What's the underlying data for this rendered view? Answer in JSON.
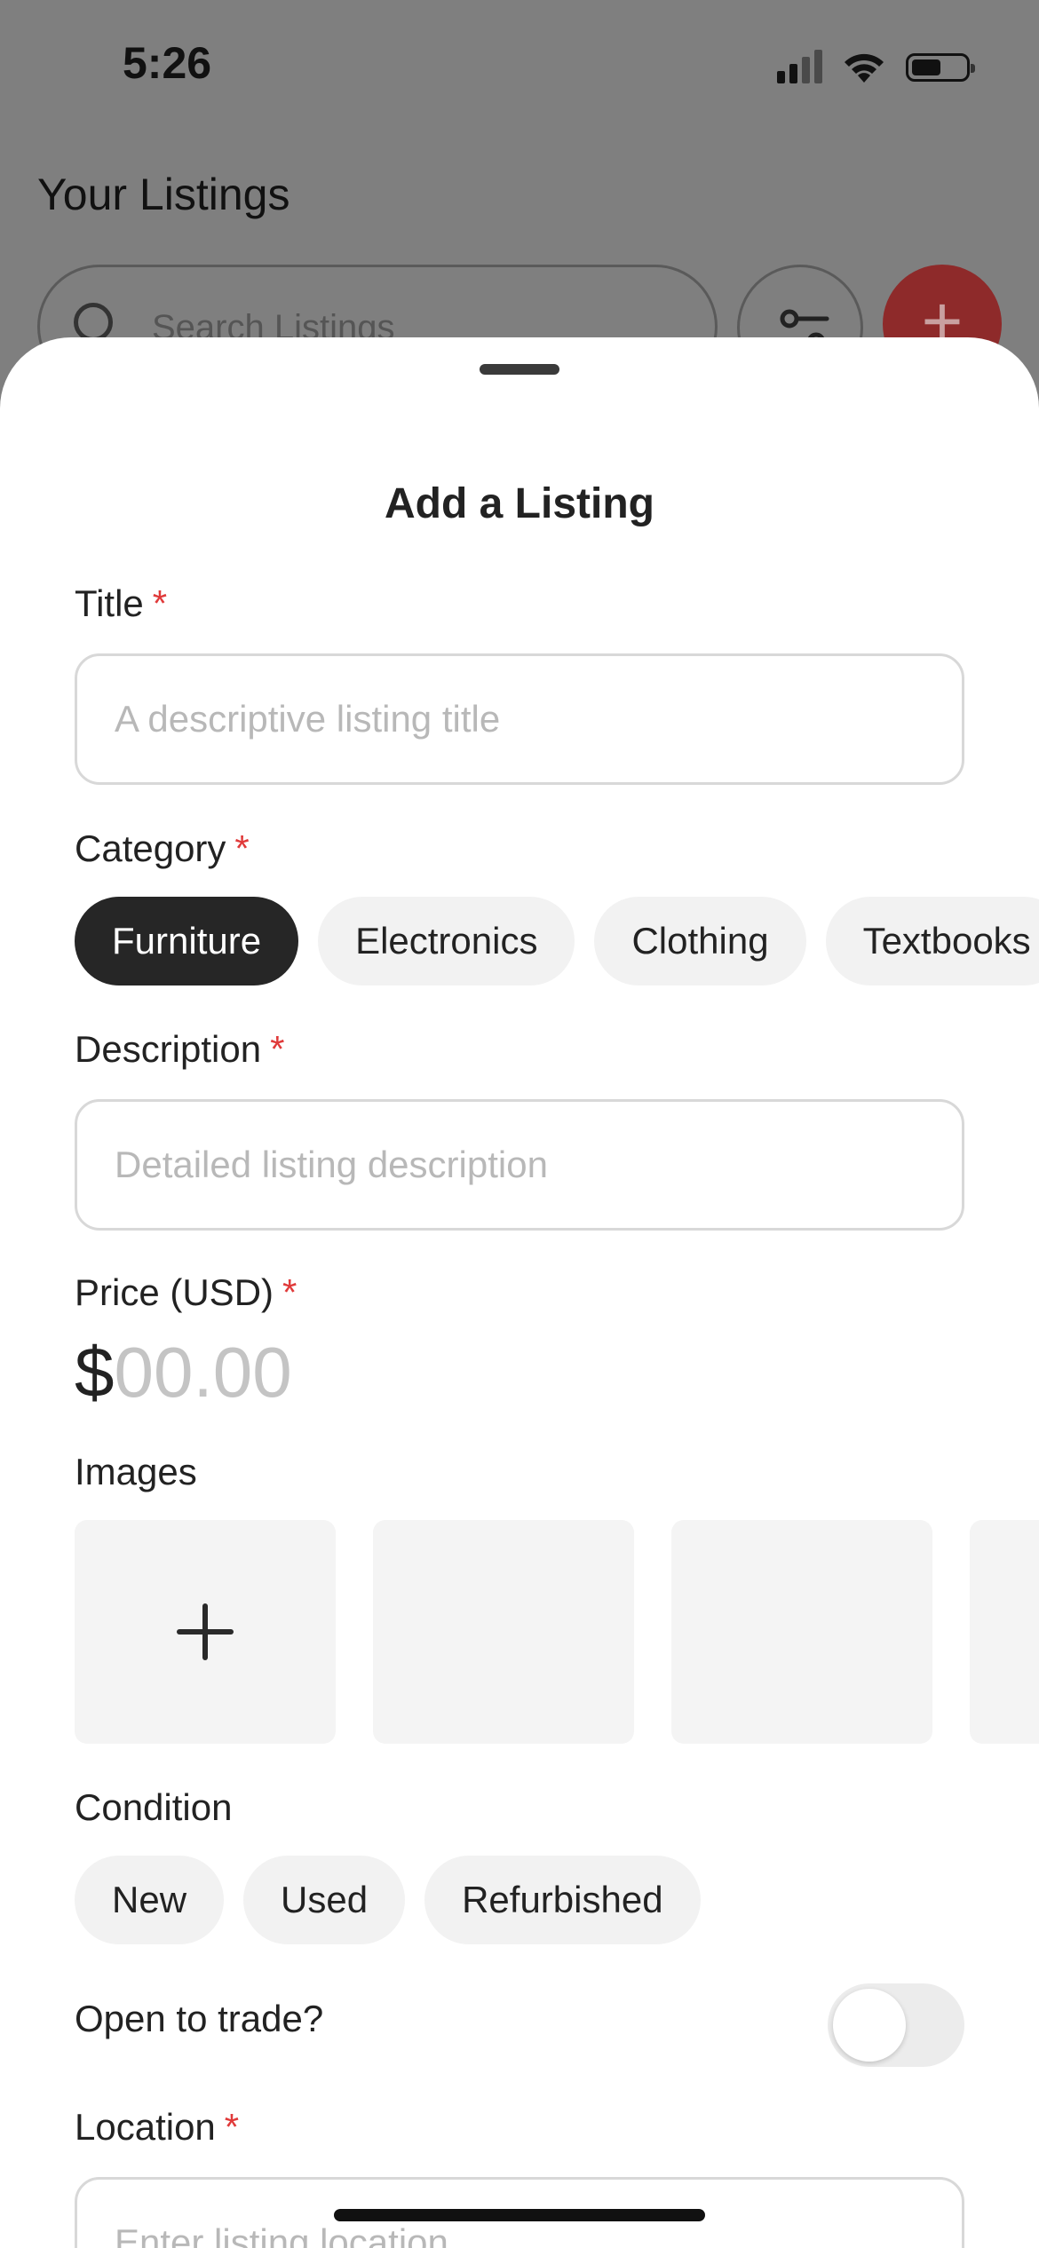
{
  "status_bar": {
    "time": "5:26"
  },
  "background_screen": {
    "title": "Your Listings",
    "search_placeholder": "Search Listings",
    "add_button_symbol": "+",
    "accent_color": "#8e2a2a"
  },
  "sheet": {
    "title": "Add a Listing",
    "title_field": {
      "label": "Title",
      "required_mark": "*",
      "placeholder": "A descriptive listing title",
      "value": ""
    },
    "category": {
      "label": "Category",
      "required_mark": "*",
      "options": [
        "Furniture",
        "Electronics",
        "Clothing",
        "Textbooks"
      ],
      "selected": "Furniture"
    },
    "description": {
      "label": "Description",
      "required_mark": "*",
      "placeholder": "Detailed listing description",
      "value": ""
    },
    "price": {
      "label": "Price (USD)",
      "required_mark": "*",
      "currency_symbol": "$",
      "placeholder": "00.00"
    },
    "images": {
      "label": "Images",
      "add_icon": "plus-icon",
      "slot_count": 4
    },
    "condition": {
      "label": "Condition",
      "options": [
        "New",
        "Used",
        "Refurbished"
      ],
      "selected": null
    },
    "trade": {
      "label": "Open to trade?",
      "enabled": false
    },
    "location": {
      "label": "Location",
      "required_mark": "*",
      "placeholder": "Enter listing location",
      "value": ""
    }
  },
  "colors": {
    "required": "#e03a3a",
    "selected_chip": "#262626",
    "chip": "#f2f2f2",
    "overlay": "#7f7f7f"
  }
}
